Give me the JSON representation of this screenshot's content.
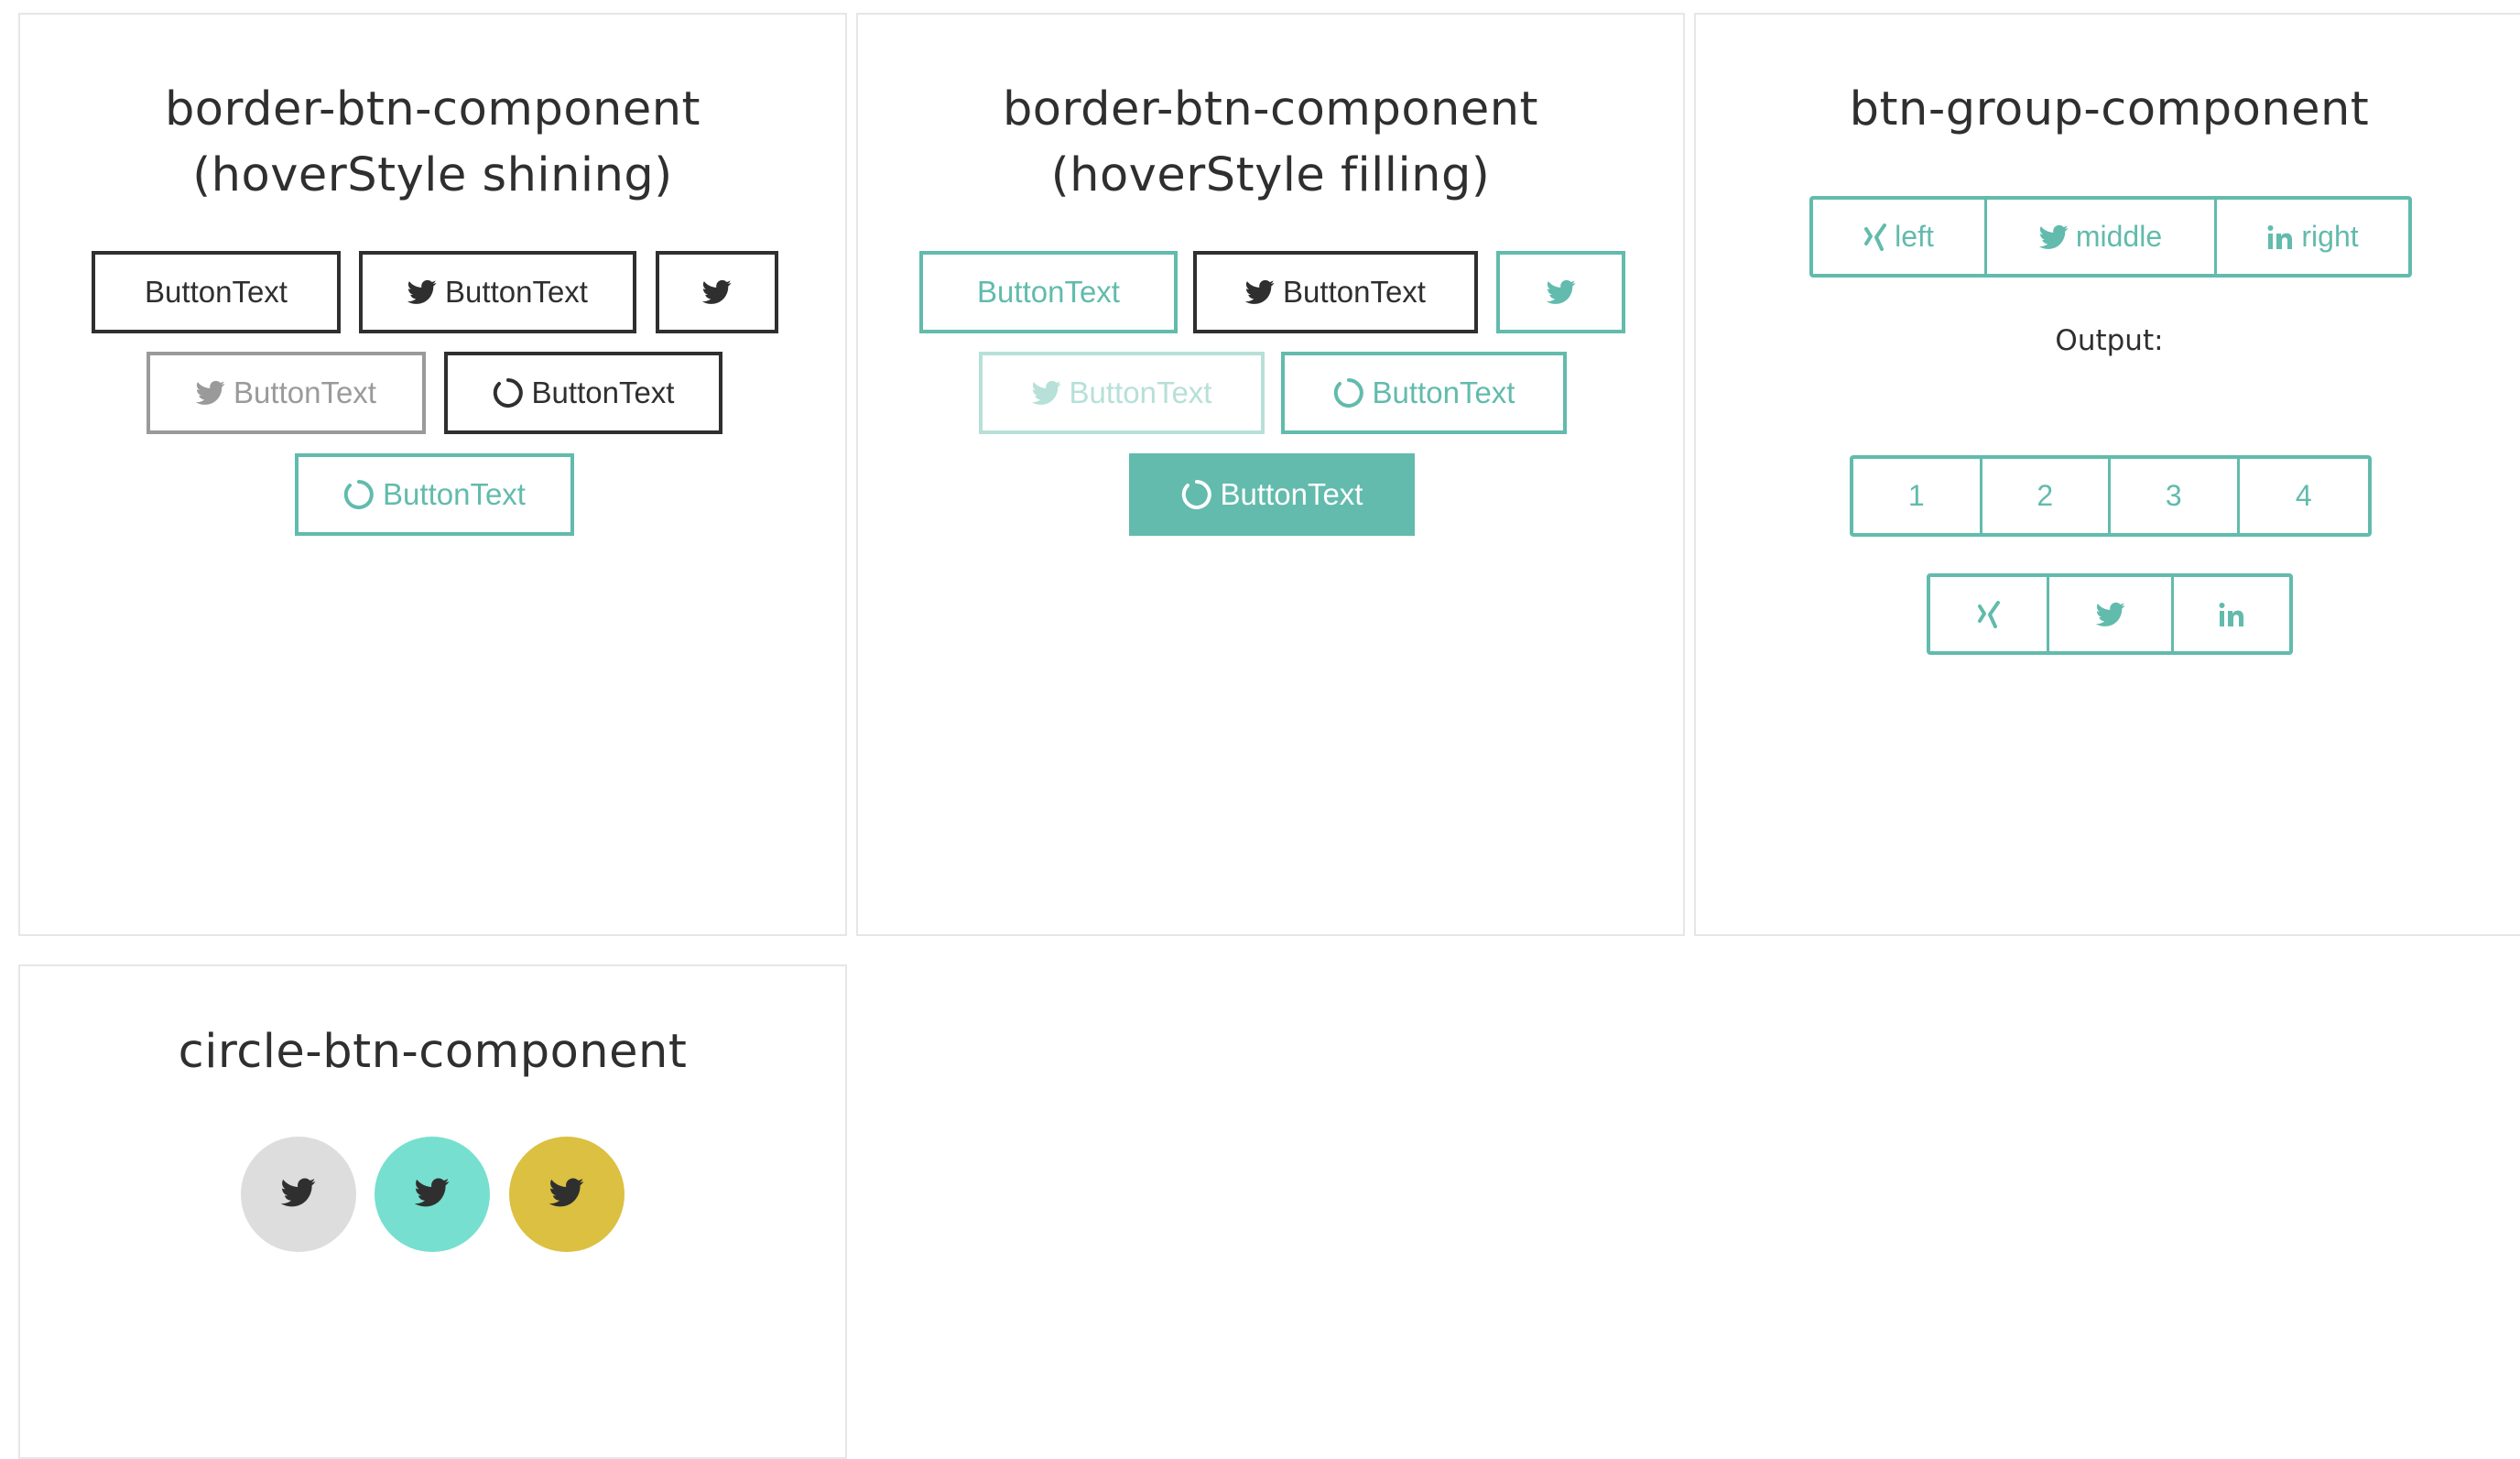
{
  "colors": {
    "dark": "#2f2f2f",
    "grey": "#9a9a9a",
    "teal": "#62bbac",
    "teal_light": "#b6e0d8",
    "circle_grey": "#dddddd",
    "circle_mint": "#77dfcf",
    "circle_gold": "#dbc041"
  },
  "icons": {
    "twitter": "twitter-icon",
    "spinner": "spinner-icon",
    "xing": "xing-icon",
    "linkedin": "linkedin-icon"
  },
  "shining": {
    "title": "border-btn-component (hoverStyle shining)",
    "buttons": [
      "ButtonText",
      "ButtonText",
      "ButtonText",
      "ButtonText",
      "ButtonText"
    ]
  },
  "filling": {
    "title": "border-btn-component (hoverStyle filling)",
    "buttons": [
      "ButtonText",
      "ButtonText",
      "ButtonText",
      "ButtonText",
      "ButtonText"
    ]
  },
  "btn_group": {
    "title": "btn-group-component",
    "labels": [
      "left",
      "middle",
      "right"
    ],
    "output_label": "Output:",
    "numbers": [
      "1",
      "2",
      "3",
      "4"
    ]
  },
  "circle": {
    "title": "circle-btn-component"
  }
}
